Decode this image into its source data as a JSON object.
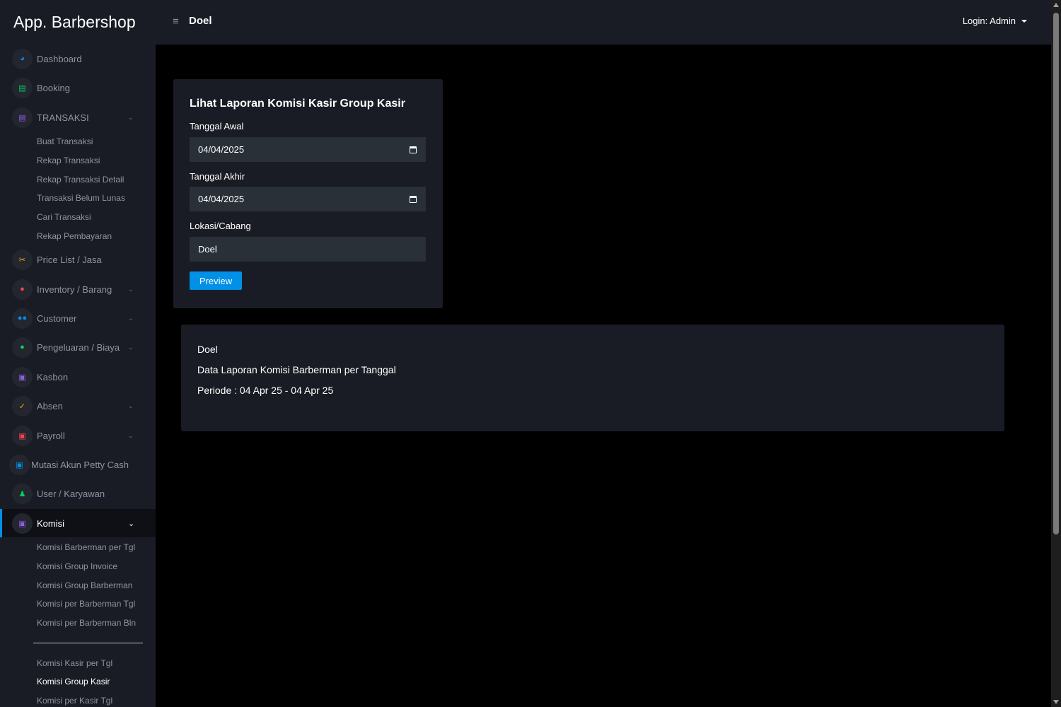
{
  "header": {
    "brand": "App. Barbershop",
    "page_title": "Doel",
    "login_label": "Login: Admin"
  },
  "sidebar": {
    "items": [
      {
        "label": "Dashboard",
        "icon": "speedometer-icon",
        "color": "#0090e7"
      },
      {
        "label": "Booking",
        "icon": "clipboard-icon",
        "color": "#00d25b"
      },
      {
        "label": "TRANSAKSI",
        "icon": "receipt-icon",
        "color": "#8f5fe8"
      },
      {
        "label": "Price List / Jasa",
        "icon": "scissors-icon",
        "color": "#ffab00"
      },
      {
        "label": "Inventory / Barang",
        "icon": "shield-icon",
        "color": "#fc424a"
      },
      {
        "label": "Customer",
        "icon": "users-icon",
        "color": "#0090e7"
      },
      {
        "label": "Pengeluaran / Biaya",
        "icon": "shield-check-icon",
        "color": "#00d25b"
      },
      {
        "label": "Kasbon",
        "icon": "cash-icon",
        "color": "#8f5fe8"
      },
      {
        "label": "Absen",
        "icon": "check-icon",
        "color": "#ffab00"
      },
      {
        "label": "Payroll",
        "icon": "cash-red-icon",
        "color": "#fc424a"
      },
      {
        "label": "Mutasi Akun Petty Cash",
        "icon": "cash-blue-icon",
        "color": "#0090e7"
      },
      {
        "label": "User / Karyawan",
        "icon": "user-icon",
        "color": "#00d25b"
      },
      {
        "label": "Komisi",
        "icon": "cash-purple-icon",
        "color": "#8f5fe8"
      }
    ],
    "transaksi_sub": [
      "Buat Transaksi",
      "Rekap Transaksi",
      "Rekap Transaksi Detail",
      "Transaksi Belum Lunas",
      "Cari Transaksi",
      "Rekap Pembayaran"
    ],
    "komisi_sub": [
      "Komisi Barberman per Tgl",
      "Komisi Group Invoice",
      "Komisi Group Barberman",
      "Komisi per Barberman Tgl",
      "Komisi per Barberman Bln",
      "Komisi Kasir per Tgl",
      "Komisi Group Kasir",
      "Komisi per Kasir Tgl"
    ]
  },
  "form": {
    "title": "Lihat Laporan Komisi Kasir Group Kasir",
    "start_label": "Tanggal Awal",
    "start_value": "04/04/2025",
    "end_label": "Tanggal Akhir",
    "end_value": "04/04/2025",
    "location_label": "Lokasi/Cabang",
    "location_value": "Doel",
    "preview_label": "Preview"
  },
  "result": {
    "location": "Doel",
    "report_title": "Data Laporan Komisi Barberman per Tanggal",
    "period": "Periode : 04 Apr 25 - 04 Apr 25"
  }
}
